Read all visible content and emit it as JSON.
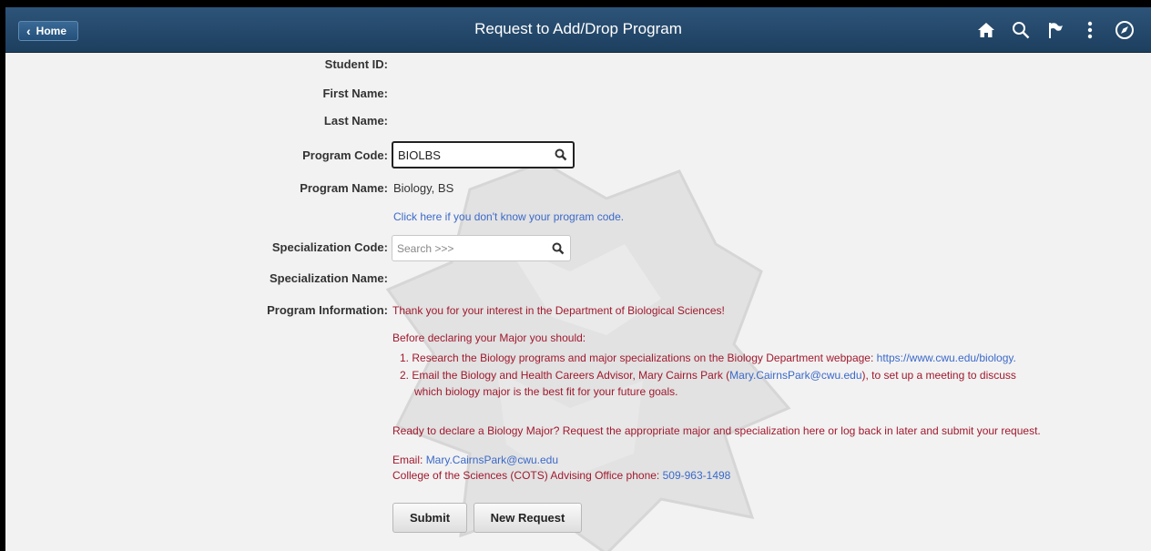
{
  "header": {
    "home_label": "Home",
    "title": "Request to Add/Drop Program",
    "icons": [
      "home-icon",
      "search-icon",
      "flag-icon",
      "more-icon",
      "navbar-compass-icon"
    ]
  },
  "form": {
    "student_id_label": "Student ID:",
    "first_name_label": "First Name:",
    "last_name_label": "Last Name:",
    "program_code_label": "Program Code:",
    "program_code_value": "BIOLBS",
    "program_name_label": "Program Name:",
    "program_name_value": "Biology, BS",
    "program_code_help_link": "Click here if you don't know your program code.",
    "specialization_code_label": "Specialization Code:",
    "specialization_code_placeholder": "Search >>>",
    "specialization_name_label": "Specialization Name:",
    "program_information_label": "Program Information:"
  },
  "info": {
    "thanks": "Thank you for your interest in the Department of Biological Sciences!",
    "before": "Before declaring your Major you should:",
    "step1_num": "1.",
    "step1_text": "Research the Biology programs and major specializations on the Biology Department webpage:",
    "step1_link": "https://www.cwu.edu/biology.",
    "step2_num": "2.",
    "step2_text_a": "Email the Biology and Health Careers Advisor, Mary Cairns Park (",
    "step2_email": "Mary.CairnsPark@cwu.edu",
    "step2_text_b": "),  to set up a meeting to discuss",
    "step2_text_c": "which biology major is the best fit for your future goals.",
    "ready": "Ready to declare a Biology Major? Request the appropriate major and specialization here or log back in later and submit your request.",
    "email_label": "Email:",
    "email_value": "Mary.CairnsPark@cwu.edu",
    "phone_label": "College of the Sciences (COTS) Advising Office phone:",
    "phone_value": "509-963-1498"
  },
  "buttons": {
    "submit": "Submit",
    "new_request": "New Request"
  },
  "colors": {
    "header": "#2d5479",
    "info_text": "#a0192d",
    "link": "#3b69c9",
    "background": "#f2f2f2"
  }
}
